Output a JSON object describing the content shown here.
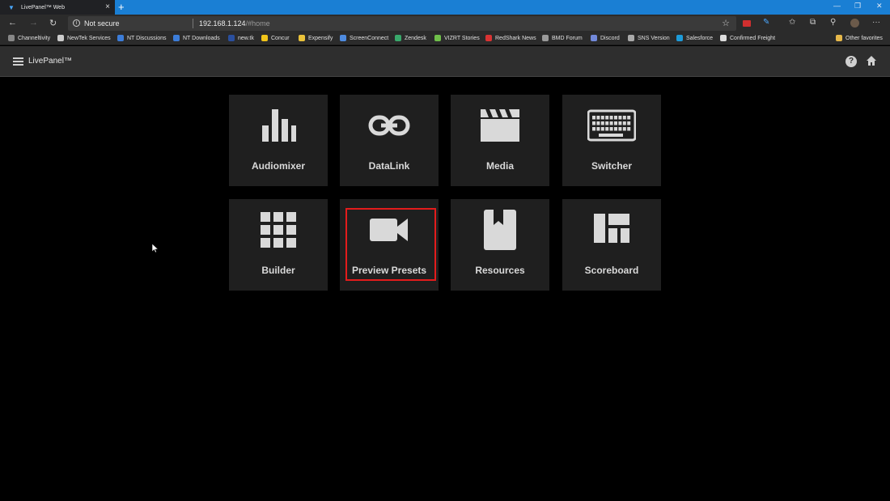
{
  "browser": {
    "tab_title": "LivePanel™ Web",
    "new_tab": "+",
    "address": {
      "security": "Not secure",
      "host": "192.168.1.124",
      "path": "/#home"
    },
    "bookmarks": [
      {
        "label": "Channeltivity",
        "color": "#888888"
      },
      {
        "label": "NewTek Services",
        "color": "#cccccc"
      },
      {
        "label": "NT Discussions",
        "color": "#3c7dd9"
      },
      {
        "label": "NT Downloads",
        "color": "#3c7dd9"
      },
      {
        "label": "new.tk",
        "color": "#2a4f9e"
      },
      {
        "label": "Concur",
        "color": "#f0c419"
      },
      {
        "label": "Expensify",
        "color": "#e9c23a"
      },
      {
        "label": "ScreenConnect",
        "color": "#4e8be0"
      },
      {
        "label": "Zendesk",
        "color": "#39a86b"
      },
      {
        "label": "VIZRT Stories",
        "color": "#6fbf4a"
      },
      {
        "label": "RedShark News",
        "color": "#d93333"
      },
      {
        "label": "BMD Forum",
        "color": "#999999"
      },
      {
        "label": "Discord",
        "color": "#7289da"
      },
      {
        "label": "SNS Version",
        "color": "#aaaaaa"
      },
      {
        "label": "Salesforce",
        "color": "#1d9bd9"
      },
      {
        "label": "Confirmed Freight",
        "color": "#dddddd"
      }
    ],
    "other_favorites": "Other favorites"
  },
  "app": {
    "title": "LivePanel™",
    "help": "?"
  },
  "tiles": [
    {
      "label": "Audiomixer",
      "icon": "bar-chart-icon"
    },
    {
      "label": "DataLink",
      "icon": "link-icon"
    },
    {
      "label": "Media",
      "icon": "clapperboard-icon"
    },
    {
      "label": "Switcher",
      "icon": "keyboard-icon"
    },
    {
      "label": "Builder",
      "icon": "grid-icon"
    },
    {
      "label": "Preview Presets",
      "icon": "video-camera-icon"
    },
    {
      "label": "Resources",
      "icon": "bookmark-icon"
    },
    {
      "label": "Scoreboard",
      "icon": "dashboard-layout-icon"
    }
  ]
}
